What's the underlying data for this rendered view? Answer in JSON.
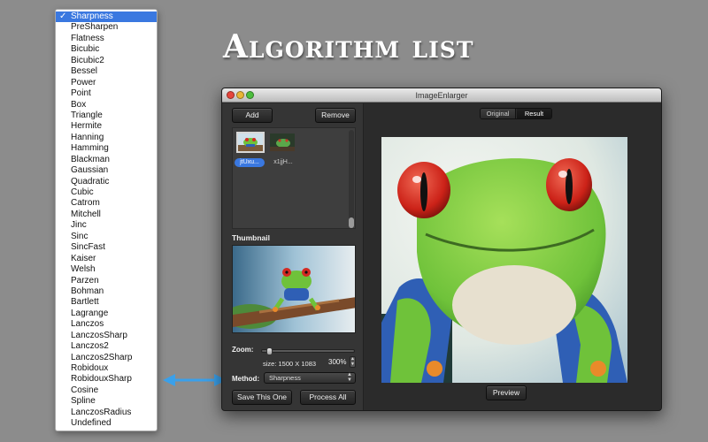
{
  "headline": "Algorithm list",
  "algorithm_menu": {
    "selected": "Sharpness",
    "check_mark": "✓",
    "items": [
      "Sharpness",
      "PreSharpen",
      "Flatness",
      "Bicubic",
      "Bicubic2",
      "Bessel",
      "Power",
      "Point",
      "Box",
      "Triangle",
      "Hermite",
      "Hanning",
      "Hamming",
      "Blackman",
      "Gaussian",
      "Quadratic",
      "Cubic",
      "Catrom",
      "Mitchell",
      "Jinc",
      "Sinc",
      "SincFast",
      "Kaiser",
      "Welsh",
      "Parzen",
      "Bohman",
      "Bartlett",
      "Lagrange",
      "Lanczos",
      "LanczosSharp",
      "Lanczos2",
      "Lanczos2Sharp",
      "Robidoux",
      "RobidouxSharp",
      "Cosine",
      "Spline",
      "LanczosRadius",
      "Undefined"
    ]
  },
  "window": {
    "title": "ImageEnlarger",
    "left_panel": {
      "add_label": "Add",
      "remove_label": "Remove",
      "files": [
        {
          "label": "jtUxu...",
          "selected": true
        },
        {
          "label": "x1jjH...",
          "selected": false
        }
      ],
      "thumbnail_label": "Thumbnail",
      "zoom_label": "Zoom:",
      "size_text": "size: 1500 X 1083",
      "zoom_percent": "300%",
      "method_label": "Method:",
      "method_value": "Sharpness",
      "save_label": "Save This One",
      "process_all_label": "Process All"
    },
    "right_panel": {
      "tabs": [
        {
          "label": "Original",
          "active": false
        },
        {
          "label": "Result",
          "active": true
        }
      ],
      "preview_label": "Preview"
    }
  },
  "colors": {
    "background": "#8c8c8c",
    "selection": "#3a78e0",
    "arrow": "#3aa0ea",
    "frog_green": "#6fc23a",
    "frog_eye": "#d32a22",
    "frog_blue": "#2f5fb5"
  },
  "icons": {
    "window_controls": [
      "close-icon",
      "minimize-icon",
      "zoom-icon"
    ],
    "arrow": "double-arrow-icon",
    "stepper": "stepper-icon",
    "select_chevron": "chevron-updown-icon"
  }
}
